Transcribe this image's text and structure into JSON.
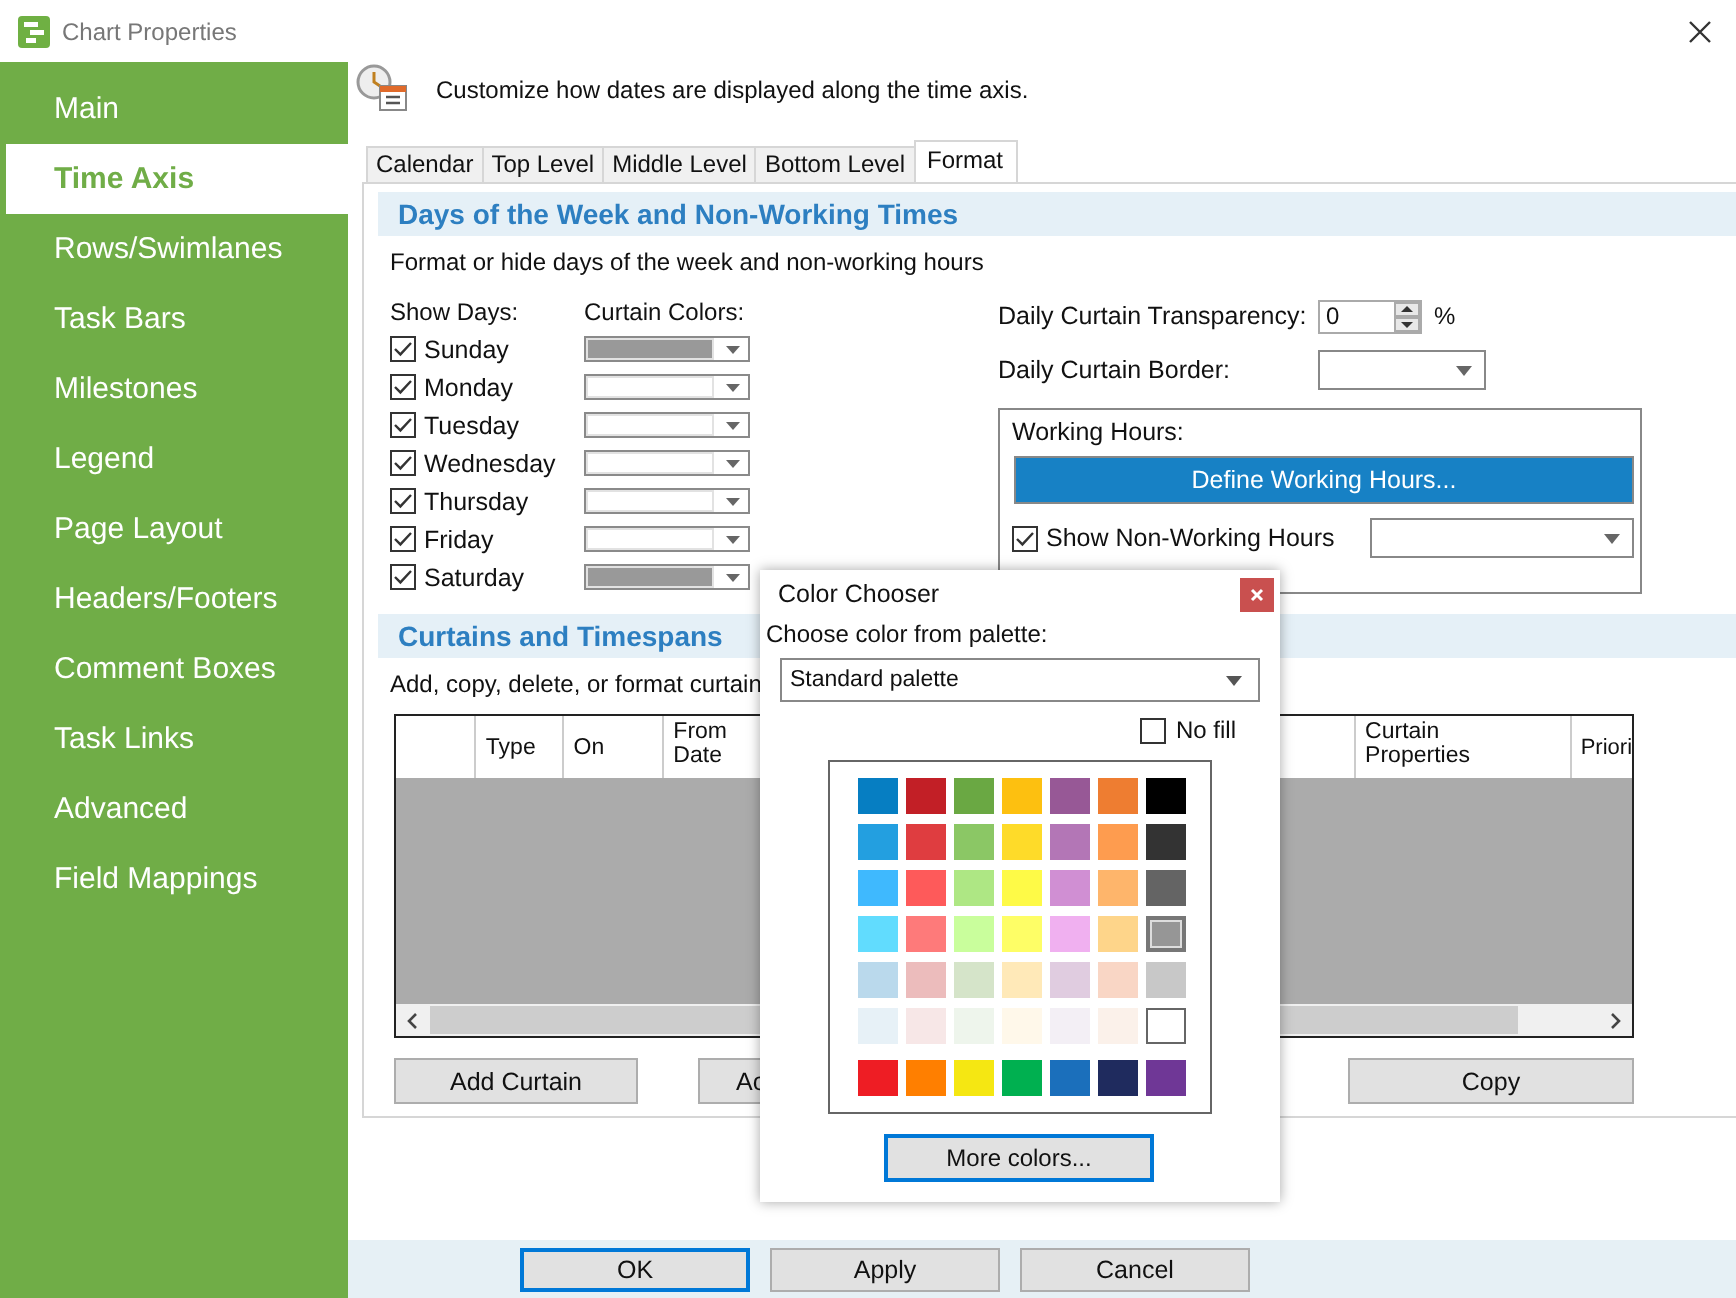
{
  "window": {
    "title": "Chart Properties"
  },
  "sidebar": {
    "items": [
      {
        "label": "Main",
        "selected": false
      },
      {
        "label": "Time Axis",
        "selected": true
      },
      {
        "label": "Rows/Swimlanes",
        "selected": false
      },
      {
        "label": "Task Bars",
        "selected": false
      },
      {
        "label": "Milestones",
        "selected": false
      },
      {
        "label": "Legend",
        "selected": false
      },
      {
        "label": "Page Layout",
        "selected": false
      },
      {
        "label": "Headers/Footers",
        "selected": false
      },
      {
        "label": "Comment Boxes",
        "selected": false
      },
      {
        "label": "Task Links",
        "selected": false
      },
      {
        "label": "Advanced",
        "selected": false
      },
      {
        "label": "Field Mappings",
        "selected": false
      }
    ]
  },
  "intro": "Customize how dates are displayed along the time axis.",
  "tabs": [
    {
      "label": "Calendar",
      "selected": false
    },
    {
      "label": "Top Level",
      "selected": false
    },
    {
      "label": "Middle Level",
      "selected": false
    },
    {
      "label": "Bottom Level",
      "selected": false
    },
    {
      "label": "Format",
      "selected": true
    }
  ],
  "days_section": {
    "title": "Days of the Week and Non-Working Times",
    "description": "Format or hide days of the week and non-working hours",
    "show_days_label": "Show Days:",
    "curtain_colors_label": "Curtain Colors:",
    "days": [
      {
        "label": "Sunday",
        "checked": true,
        "color": "#999999"
      },
      {
        "label": "Monday",
        "checked": true,
        "color": "#ffffff"
      },
      {
        "label": "Tuesday",
        "checked": true,
        "color": "#ffffff"
      },
      {
        "label": "Wednesday",
        "checked": true,
        "color": "#ffffff"
      },
      {
        "label": "Thursday",
        "checked": true,
        "color": "#ffffff"
      },
      {
        "label": "Friday",
        "checked": true,
        "color": "#ffffff"
      },
      {
        "label": "Saturday",
        "checked": true,
        "color": "#999999"
      }
    ]
  },
  "transparency": {
    "label": "Daily Curtain Transparency:",
    "value": "0",
    "unit": "%"
  },
  "border": {
    "label": "Daily Curtain Border:"
  },
  "working_hours": {
    "title": "Working Hours:",
    "button": "Define Working Hours...",
    "show_non_working": {
      "label": "Show Non-Working Hours",
      "checked": true
    }
  },
  "curtains_section": {
    "title": "Curtains and Timespans",
    "description": "Add, copy, delete, or format curtain",
    "columns": [
      {
        "label": "Type"
      },
      {
        "label": "On"
      },
      {
        "label": "From Date"
      },
      {
        "label": "Curtain Properties"
      },
      {
        "label": "Priori"
      }
    ],
    "buttons": [
      "Add Curtain",
      "Ac",
      "Copy"
    ]
  },
  "footer": {
    "buttons": [
      {
        "label": "OK",
        "focused": true
      },
      {
        "label": "Apply",
        "focused": false
      },
      {
        "label": "Cancel",
        "focused": false
      }
    ]
  },
  "color_chooser": {
    "title": "Color Chooser",
    "palette_label": "Choose color from palette:",
    "palette": "Standard palette",
    "no_fill": {
      "label": "No fill",
      "checked": false
    },
    "shades": [
      [
        {
          "color": "#067ec2",
          "selected": false
        },
        {
          "color": "#c21f26",
          "selected": false
        },
        {
          "color": "#6aa843",
          "selected": false
        },
        {
          "color": "#fdc010",
          "selected": false
        },
        {
          "color": "#975896",
          "selected": false
        },
        {
          "color": "#ee7d31",
          "selected": false
        },
        {
          "color": "#000000",
          "selected": false
        }
      ],
      [
        {
          "color": "#239fe0",
          "selected": false
        },
        {
          "color": "#df3d40",
          "selected": false
        },
        {
          "color": "#8bc765",
          "selected": false
        },
        {
          "color": "#fedb29",
          "selected": false
        },
        {
          "color": "#b376b6",
          "selected": false
        },
        {
          "color": "#fe9c4f",
          "selected": false
        },
        {
          "color": "#333333",
          "selected": false
        }
      ],
      [
        {
          "color": "#3fb9fe",
          "selected": false
        },
        {
          "color": "#fe5a5a",
          "selected": false
        },
        {
          "color": "#aee784",
          "selected": false
        },
        {
          "color": "#fefa47",
          "selected": false
        },
        {
          "color": "#d08fd3",
          "selected": false
        },
        {
          "color": "#feb56b",
          "selected": false
        },
        {
          "color": "#646464",
          "selected": false
        }
      ],
      [
        {
          "color": "#61dcfe",
          "selected": false
        },
        {
          "color": "#fe7a7a",
          "selected": false
        },
        {
          "color": "#c9fe9c",
          "selected": false
        },
        {
          "color": "#fefe66",
          "selected": false
        },
        {
          "color": "#f0b0f0",
          "selected": false
        },
        {
          "color": "#fed58a",
          "selected": false
        },
        {
          "color": "#969696",
          "selected": true
        }
      ],
      [
        {
          "color": "#bad9ec",
          "selected": false
        },
        {
          "color": "#ecbcbc",
          "selected": false
        },
        {
          "color": "#d5e4c9",
          "selected": false
        },
        {
          "color": "#ffe9b8",
          "selected": false
        },
        {
          "color": "#e0cce0",
          "selected": false
        },
        {
          "color": "#f9d6c5",
          "selected": false
        },
        {
          "color": "#c8c8c8",
          "selected": false
        }
      ],
      [
        {
          "color": "#e7f1f7",
          "selected": false
        },
        {
          "color": "#f7e7e7",
          "selected": false
        },
        {
          "color": "#eef5ec",
          "selected": false
        },
        {
          "color": "#fff8ea",
          "selected": false
        },
        {
          "color": "#f3eff5",
          "selected": false
        },
        {
          "color": "#fbf1ea",
          "selected": false
        },
        {
          "color": "#ffffff",
          "selected": false
        }
      ]
    ],
    "standard": [
      {
        "color": "#ee1d24",
        "selected": false
      },
      {
        "color": "#ff7f00",
        "selected": false
      },
      {
        "color": "#f5e712",
        "selected": false
      },
      {
        "color": "#00b050",
        "selected": false
      },
      {
        "color": "#1b6fbb",
        "selected": false
      },
      {
        "color": "#1f2b5e",
        "selected": false
      },
      {
        "color": "#6f3796",
        "selected": false
      }
    ],
    "more_colors": "More colors..."
  }
}
